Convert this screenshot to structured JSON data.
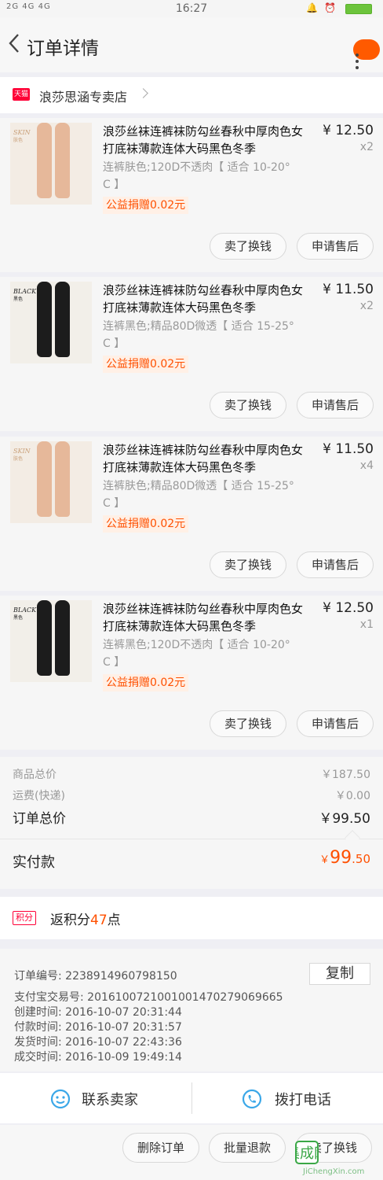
{
  "status": {
    "left": "2G 4G 4G",
    "time": "16:27",
    "right": "🔔 ⏰"
  },
  "nav": {
    "title": "订单详情"
  },
  "shop": {
    "badge": "天猫",
    "name": "浪莎思涵专卖店"
  },
  "items": [
    {
      "title": "浪莎丝袜连裤袜防勾丝春秋中厚肉色女打底袜薄款连体大码黑色冬季",
      "price": "¥ 12.50",
      "qty": "x2",
      "sku": "连裤肤色;120D不透肉【 适合 10-20° C 】",
      "donate": "公益捐赠0.02元",
      "btn1": "卖了换钱",
      "btn2": "申请售后",
      "tag": "SKIN",
      "tag2": "肤色",
      "color": "#e6b89a"
    },
    {
      "title": "浪莎丝袜连裤袜防勾丝春秋中厚肉色女打底袜薄款连体大码黑色冬季",
      "price": "¥ 11.50",
      "qty": "x2",
      "sku": "连裤黑色;精品80D微透【 适合 15-25° C 】",
      "donate": "公益捐赠0.02元",
      "btn1": "卖了换钱",
      "btn2": "申请售后",
      "tag": "BLACK",
      "tag2": "黑色",
      "color": "#1c1c1c"
    },
    {
      "title": "浪莎丝袜连裤袜防勾丝春秋中厚肉色女打底袜薄款连体大码黑色冬季",
      "price": "¥ 11.50",
      "qty": "x4",
      "sku": "连裤肤色;精品80D微透【 适合 15-25° C 】",
      "donate": "公益捐赠0.02元",
      "btn1": "卖了换钱",
      "btn2": "申请售后",
      "tag": "SKIN",
      "tag2": "肤色",
      "color": "#e6b89a"
    },
    {
      "title": "浪莎丝袜连裤袜防勾丝春秋中厚肉色女打底袜薄款连体大码黑色冬季",
      "price": "¥ 12.50",
      "qty": "x1",
      "sku": "连裤黑色;120D不透肉【 适合 10-20° C 】",
      "donate": "公益捐赠0.02元",
      "btn1": "卖了换钱",
      "btn2": "申请售后",
      "tag": "BLACK",
      "tag2": "黑色",
      "color": "#1c1c1c"
    }
  ],
  "summary": {
    "goods_label": "商品总价",
    "goods_value": "￥187.50",
    "ship_label": "运费(快递)",
    "ship_value": "￥0.00",
    "total_label": "订单总价",
    "total_value": "￥99.50",
    "paid_label": "实付款",
    "paid_currency": "￥",
    "paid_int": "99",
    "paid_dec": ".50"
  },
  "points": {
    "badge": "积分",
    "prefix": "返积分",
    "value": "47",
    "suffix": "点"
  },
  "info": {
    "order_no_label": "订单编号:",
    "order_no": "2238914960798150",
    "copy": "复制",
    "alipay_label": "支付宝交易号:",
    "alipay": "2016100721001001470279069665",
    "created_label": "创建时间:",
    "created": "2016-10-07  20:31:44",
    "paid_label": "付款时间:",
    "paid": "2016-10-07  20:31:57",
    "shipped_label": "发货时间:",
    "shipped": "2016-10-07  22:43:36",
    "done_label": "成交时间:",
    "done": "2016-10-09  19:49:14"
  },
  "contact": {
    "seller": "联系卖家",
    "phone": "拨打电话"
  },
  "bottom": {
    "delete": "删除订单",
    "refund": "批量退款",
    "sell": "卖了换钱"
  },
  "watermark": {
    "brand": "集成网",
    "url": "JiChengXin.com"
  },
  "colors": {
    "accent": "#ff5000",
    "tmall": "#ff0036",
    "contact_icon": "#3aa7e8"
  }
}
